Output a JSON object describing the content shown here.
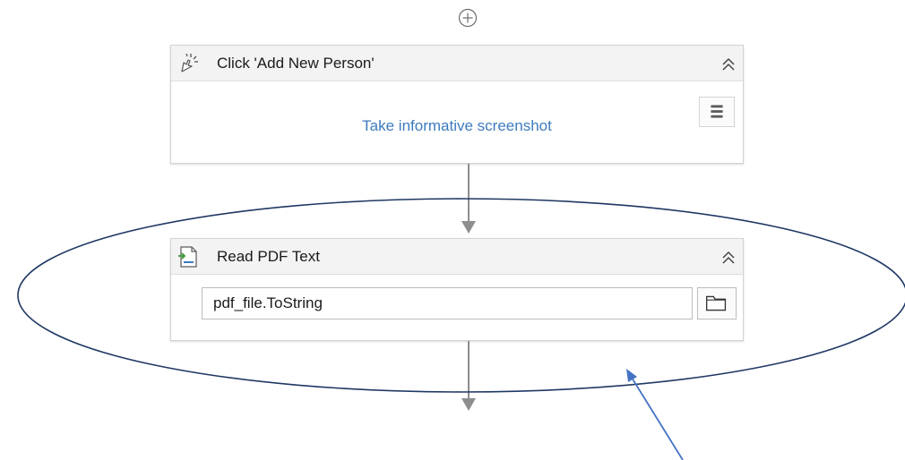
{
  "add_activity": {
    "icon": "plus-circle-icon"
  },
  "activities": [
    {
      "title": "Click 'Add New Person'",
      "icon": "click-cursor-icon",
      "collapse_icon": "double-chevron-up-icon",
      "link": "Take informative screenshot",
      "menu_icon": "hamburger-menu-icon"
    },
    {
      "title": "Read PDF Text",
      "icon": "read-pdf-icon",
      "collapse_icon": "double-chevron-up-icon",
      "field_value": "pdf_file.ToString",
      "browse_icon": "folder-icon"
    }
  ],
  "annotation": {
    "ellipse_color": "#1f3864",
    "arrow_color": "#4472c4"
  }
}
